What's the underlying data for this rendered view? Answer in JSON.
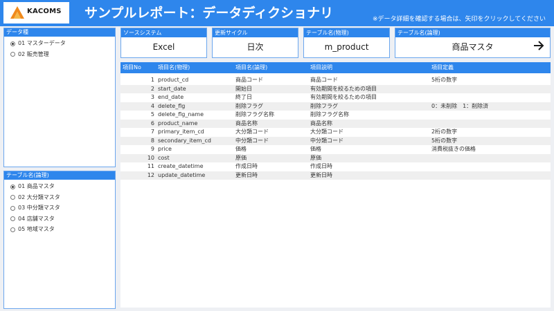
{
  "header": {
    "logo_text": "KACOMS",
    "title": "サンプルレポート：データディクショナリ",
    "hint": "※データ詳細を確認する場合は、矢印をクリックしてください"
  },
  "data_type_panel": {
    "title": "データ種",
    "options": [
      {
        "label": "01 マスターデータ",
        "selected": true
      },
      {
        "label": "02 販売管理",
        "selected": false
      }
    ]
  },
  "table_name_panel": {
    "title": "テーブル名(論理)",
    "options": [
      {
        "label": "01 商品マスタ",
        "selected": true
      },
      {
        "label": "02 大分類マスタ",
        "selected": false
      },
      {
        "label": "03 中分類マスタ",
        "selected": false
      },
      {
        "label": "04 店舗マスタ",
        "selected": false
      },
      {
        "label": "05 地域マスタ",
        "selected": false
      }
    ]
  },
  "cards": [
    {
      "label": "ソースシステム",
      "value": "Excel"
    },
    {
      "label": "更新サイクル",
      "value": "日次"
    },
    {
      "label": "テーブル名(物理)",
      "value": "m_product"
    },
    {
      "label": "テーブル名(論理)",
      "value": "商品マスタ"
    }
  ],
  "table": {
    "headers": [
      "項目No",
      "項目名(物理)",
      "項目名(論理)",
      "項目説明",
      "項目定義"
    ],
    "rows": [
      [
        "1",
        "product_cd",
        "商品コード",
        "商品コード",
        "5桁の数字"
      ],
      [
        "2",
        "start_date",
        "開始日",
        "有効期間を絞るための項目",
        ""
      ],
      [
        "3",
        "end_date",
        "終了日",
        "有効期間を絞るための項目",
        ""
      ],
      [
        "4",
        "delete_flg",
        "削除フラグ",
        "削除フラグ",
        "0：未削除　1：削除済"
      ],
      [
        "5",
        "delete_flg_name",
        "削除フラグ名称",
        "削除フラグ名称",
        ""
      ],
      [
        "6",
        "product_name",
        "商品名称",
        "商品名称",
        ""
      ],
      [
        "7",
        "primary_item_cd",
        "大分類コード",
        "大分類コード",
        "2桁の数字"
      ],
      [
        "8",
        "secondary_item_cd",
        "中分類コード",
        "中分類コード",
        "5桁の数字"
      ],
      [
        "9",
        "price",
        "価格",
        "価格",
        "消費税抜きの価格"
      ],
      [
        "10",
        "cost",
        "原価",
        "原価",
        ""
      ],
      [
        "11",
        "create_datetime",
        "作成日時",
        "作成日時",
        ""
      ],
      [
        "12",
        "update_datetime",
        "更新日時",
        "更新日時",
        ""
      ]
    ]
  },
  "colors": {
    "accent": "#2e86ec",
    "panel_border": "#6aa6ee",
    "row_alt": "#efefef",
    "background": "#eef0f4"
  },
  "icons": {
    "logo": "kacoms-logo-icon",
    "detail_arrow": "arrow-right-icon",
    "radio": "radio-icon"
  }
}
